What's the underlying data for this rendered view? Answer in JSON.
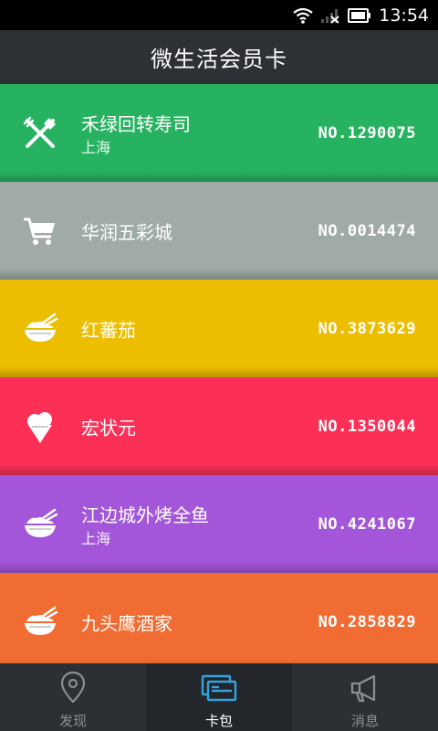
{
  "status_bar": {
    "time": "13:54"
  },
  "header": {
    "title": "微生活会员卡"
  },
  "cards": [
    {
      "name": "禾绿回转寿司",
      "city": "上海",
      "number": "NO.1290075",
      "color": "#27b261",
      "icon": "fork-knife-icon"
    },
    {
      "name": "华润五彩城",
      "city": "",
      "number": "NO.0014474",
      "color": "#a0aba6",
      "icon": "shopping-cart-icon"
    },
    {
      "name": "红蕃茄",
      "city": "",
      "number": "NO.3873629",
      "color": "#edbe00",
      "icon": "rice-bowl-icon"
    },
    {
      "name": "宏状元",
      "city": "",
      "number": "NO.1350044",
      "color": "#fc3056",
      "icon": "ice-cream-icon"
    },
    {
      "name": "江边城外烤全鱼",
      "city": "上海",
      "number": "NO.4241067",
      "color": "#a356d9",
      "icon": "rice-bowl-icon"
    },
    {
      "name": "九头鹰酒家",
      "city": "",
      "number": "NO.2858829",
      "color": "#f16c32",
      "icon": "rice-bowl-icon"
    }
  ],
  "bottom_nav": {
    "items": [
      {
        "label": "发现",
        "icon": "location-pin-icon",
        "active": false
      },
      {
        "label": "卡包",
        "icon": "card-wallet-icon",
        "active": true
      },
      {
        "label": "消息",
        "icon": "megaphone-icon",
        "active": false
      }
    ]
  }
}
